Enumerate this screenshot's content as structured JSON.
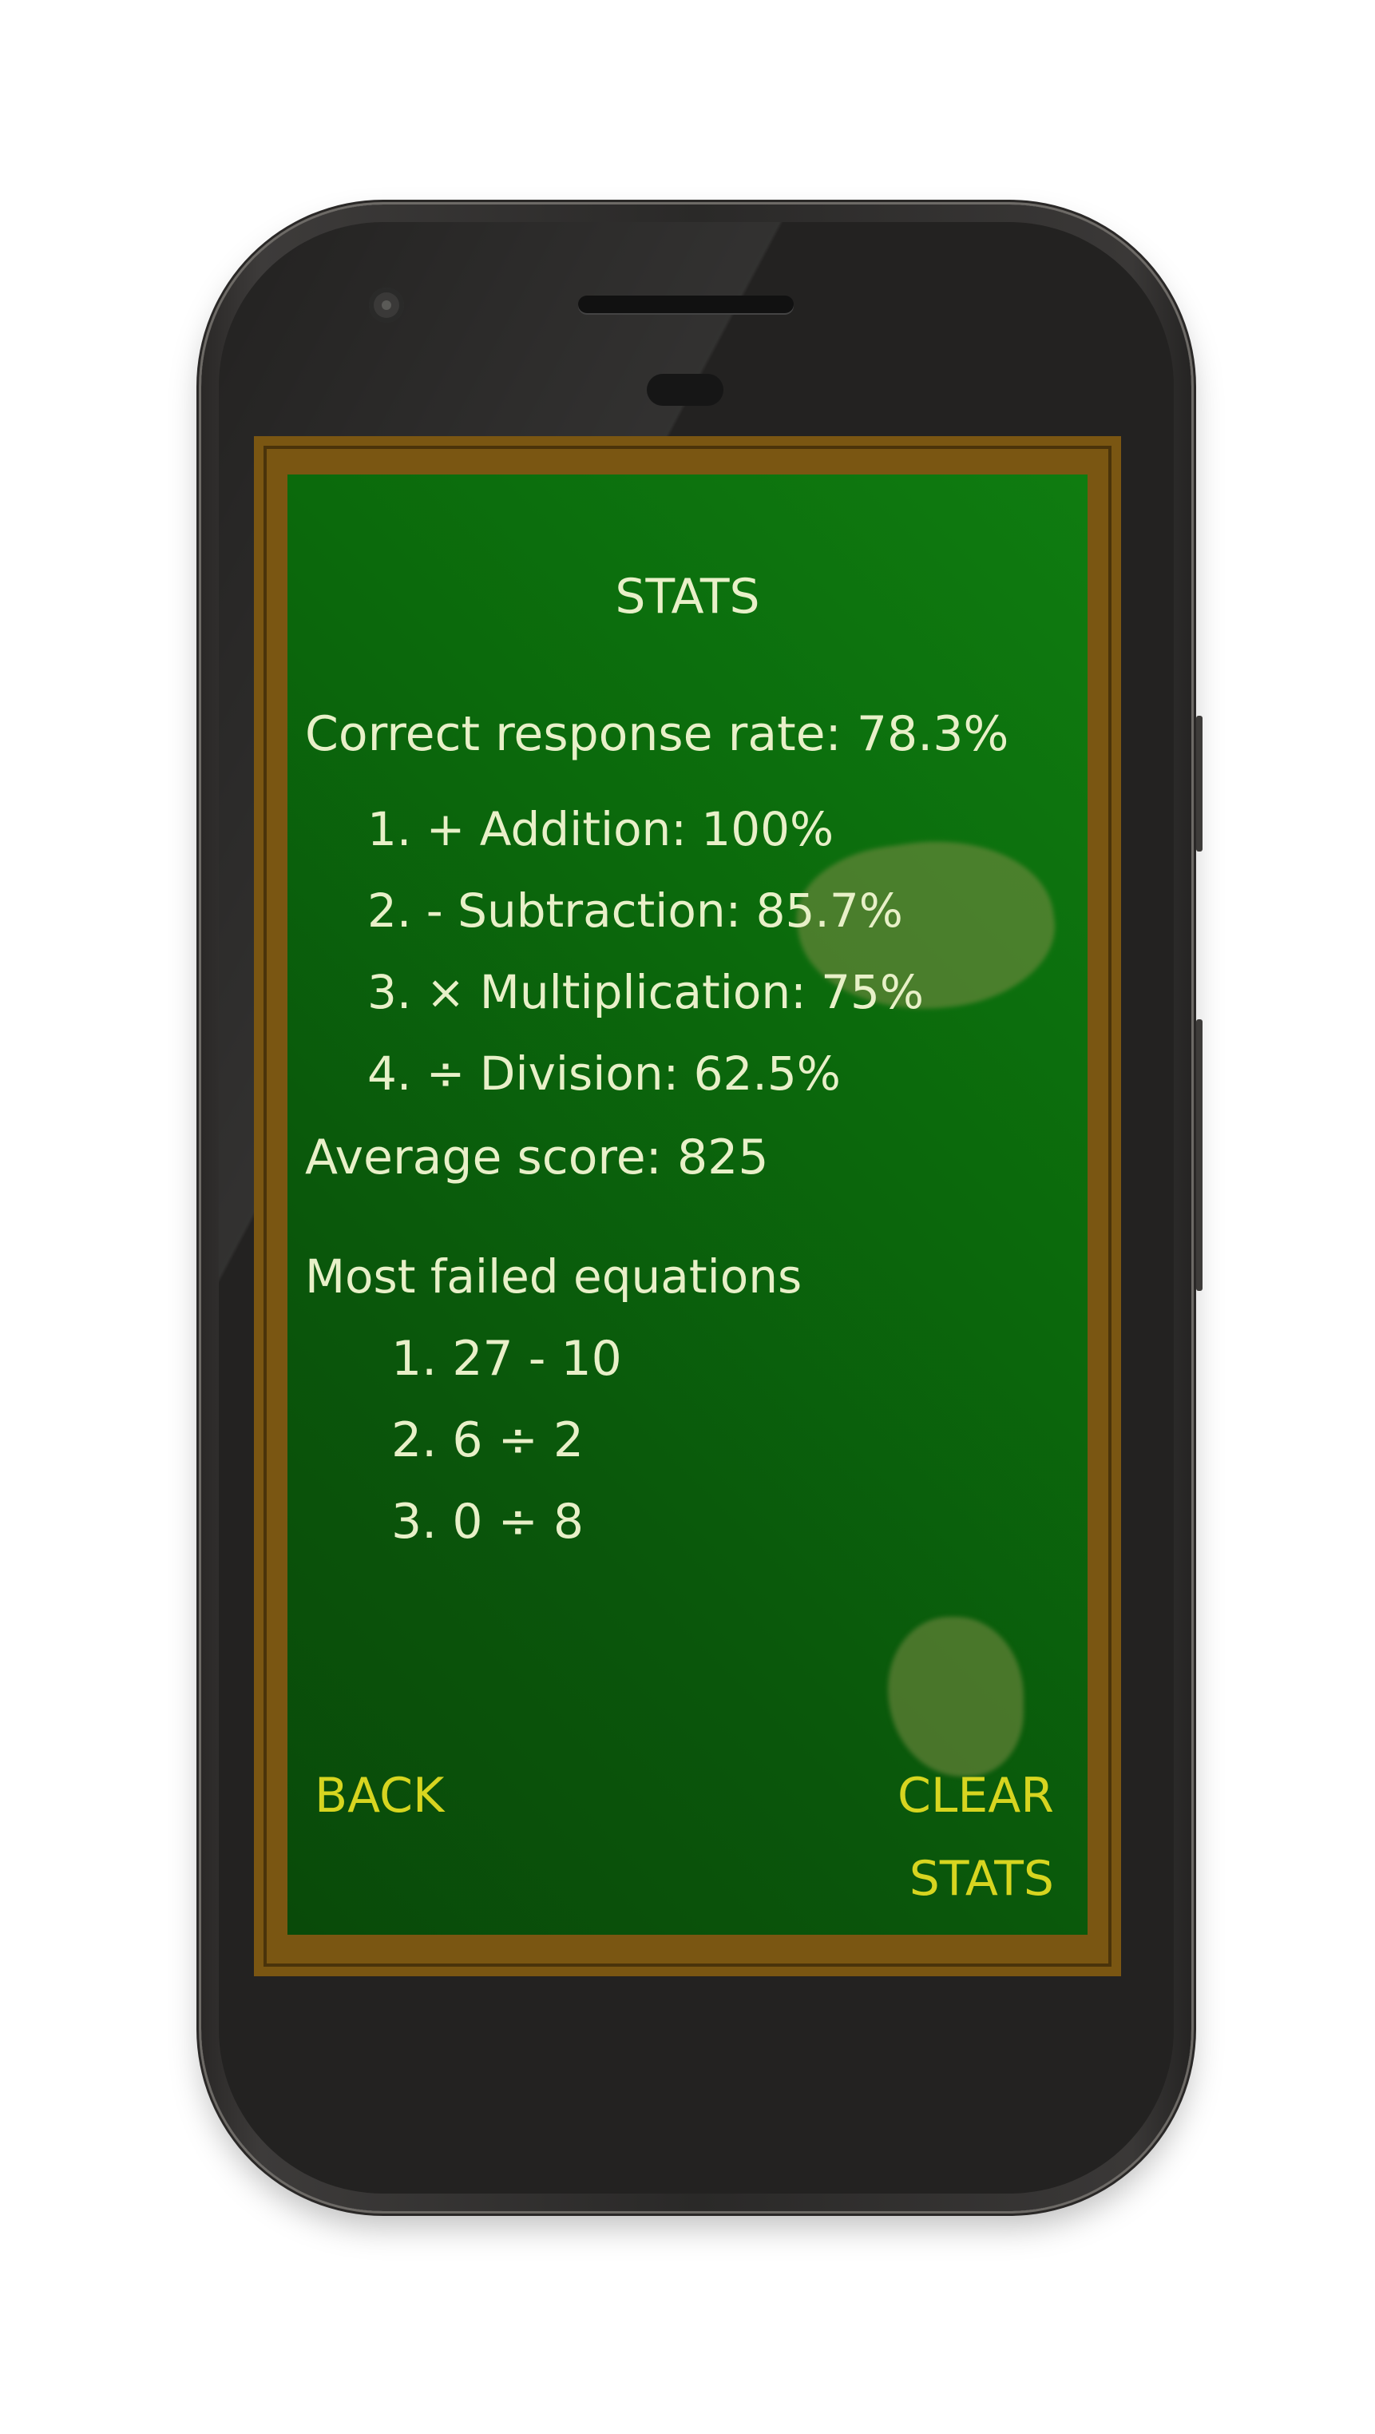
{
  "screen": {
    "title": "STATS",
    "correct_rate_label": "Correct response rate: 78.3%",
    "operations": [
      {
        "label": "1. + Addition: 100%"
      },
      {
        "label": "2. - Subtraction: 85.7%"
      },
      {
        "label": "3. × Multiplication: 75%"
      },
      {
        "label": "4. ÷ Division: 62.5%"
      }
    ],
    "average_score_label": "Average score: 825",
    "failed_heading": "Most failed equations",
    "failed_equations": [
      {
        "label": "1. 27 - 10"
      },
      {
        "label": "2. 6 ÷ 2"
      },
      {
        "label": "3. 0 ÷ 8"
      }
    ],
    "back_label": "BACK",
    "clear_line1": "CLEAR",
    "clear_line2": "STATS"
  },
  "colors": {
    "chalk_text": "#e8f0c8",
    "action_text": "#d7d520",
    "board_green": "#0b6a0c",
    "frame_brown": "#7a5612",
    "phone_body": "#2a2827"
  }
}
